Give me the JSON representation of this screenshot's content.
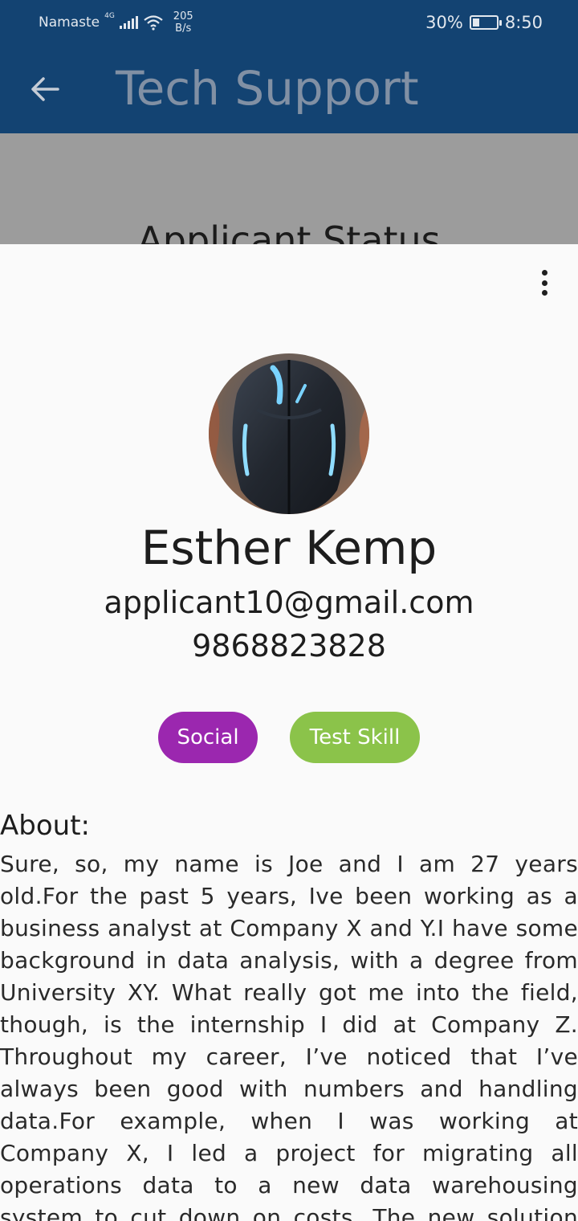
{
  "status_bar": {
    "carrier": "Namaste",
    "network": "4G",
    "speed_value": "205",
    "speed_unit": "B/s",
    "battery": "30%",
    "battery_level": 0.3,
    "time": "8:50"
  },
  "app_bar": {
    "back_icon": "arrow-left-icon",
    "title": "Tech Support"
  },
  "background_page": {
    "heading": "Applicant Status"
  },
  "profile": {
    "more_icon": "more-vert-icon",
    "avatar": "avatar-image",
    "name": "Esther Kemp",
    "email": "applicant10@gmail.com",
    "phone": "9868823828",
    "chips": [
      {
        "label": "Social",
        "color": "#9b27af"
      },
      {
        "label": "Test Skill",
        "color": "#8bc34a"
      }
    ],
    "about_label": "About:",
    "about_text": "Sure, so, my name is Joe and I am 27 years old.For the past 5 years, Ive been working as a business analyst at Company X and Y.I have some background in data analysis, with a degree from University XY. What really got me into the field, though, is the internship I did at Company Z. Throughout my career, I’ve noticed that I’ve always been good with numbers and handling data.For example, when I was working at Company X, I led a project for migrating all operations data to a new data warehousing system to cut down on costs. The new solution was a much better fit for our"
  },
  "colors": {
    "app_bar": "#134372",
    "title_text": "#8190a4",
    "sheet": "#fafafa",
    "scrim": "#9c9c9c"
  }
}
